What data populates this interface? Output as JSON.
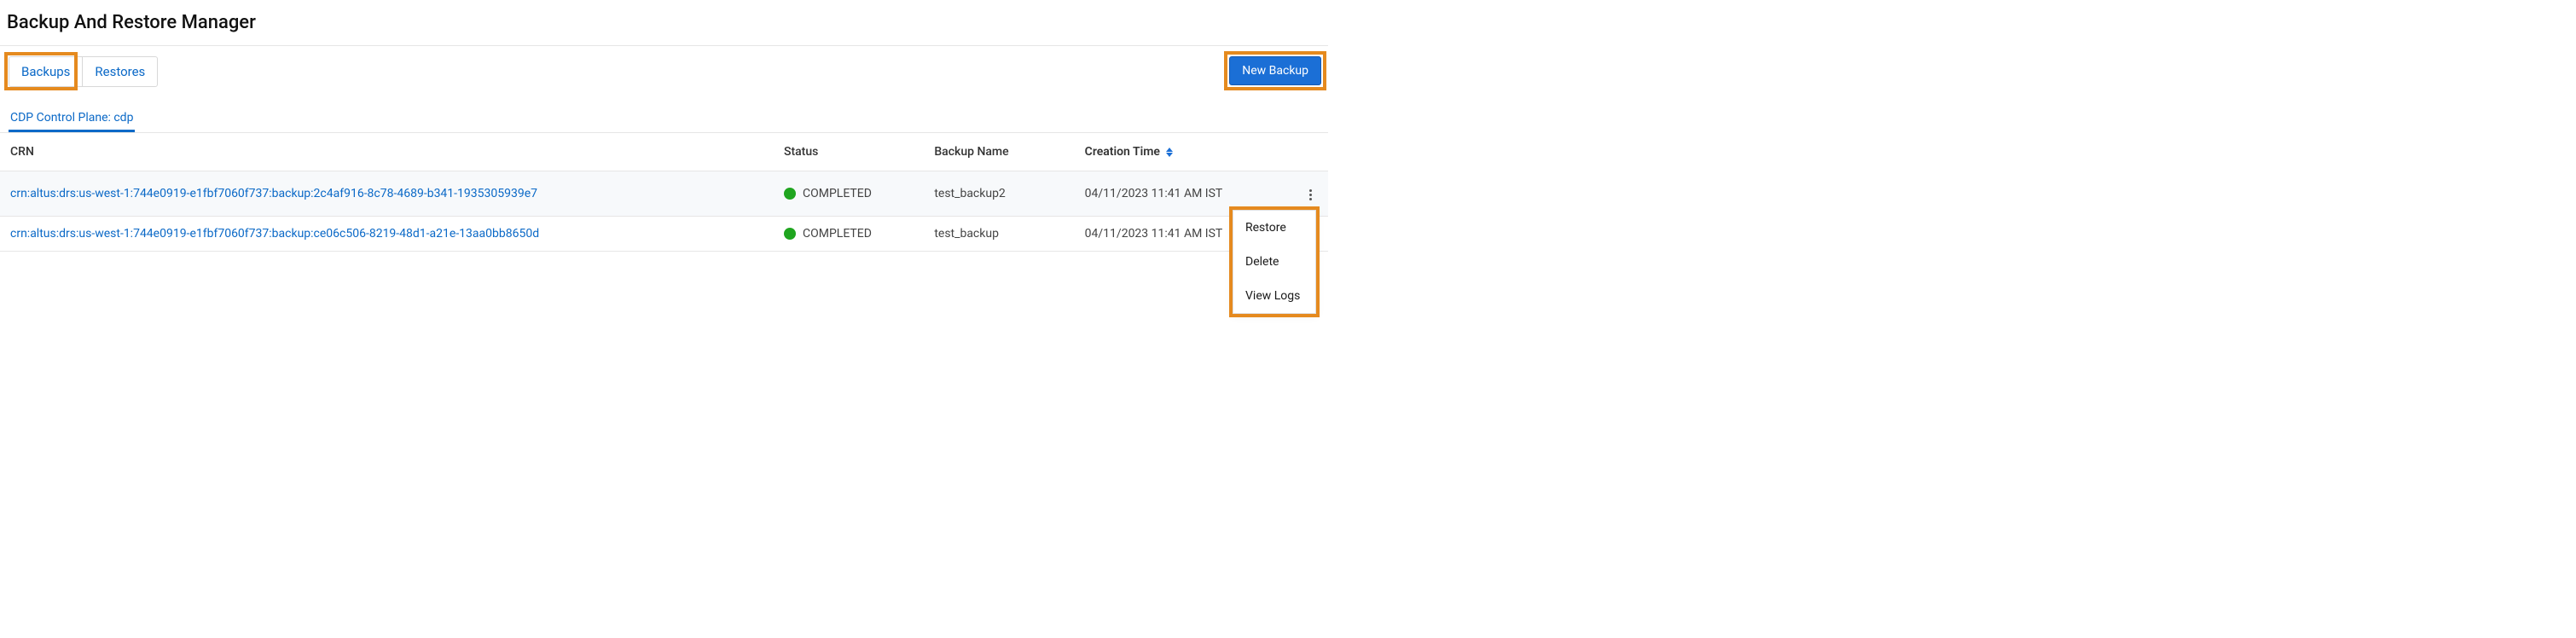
{
  "page": {
    "title": "Backup And Restore Manager"
  },
  "tabs": {
    "backups": "Backups",
    "restores": "Restores"
  },
  "new_backup_label": "New Backup",
  "subtab": {
    "label": "CDP Control Plane: cdp"
  },
  "columns": {
    "crn": "CRN",
    "status": "Status",
    "name": "Backup Name",
    "time": "Creation Time"
  },
  "rows": [
    {
      "crn": "crn:altus:drs:us-west-1:744e0919-e1fbf7060f737:backup:2c4af916-8c78-4689-b341-1935305939e7",
      "status": "COMPLETED",
      "name": "test_backup2",
      "time": "04/11/2023 11:41 AM IST"
    },
    {
      "crn": "crn:altus:drs:us-west-1:744e0919-e1fbf7060f737:backup:ce06c506-8219-48d1-a21e-13aa0bb8650d",
      "status": "COMPLETED",
      "name": "test_backup",
      "time": "04/11/2023 11:41 AM IST"
    }
  ],
  "menu": {
    "restore": "Restore",
    "delete": "Delete",
    "view_logs": "View Logs"
  }
}
